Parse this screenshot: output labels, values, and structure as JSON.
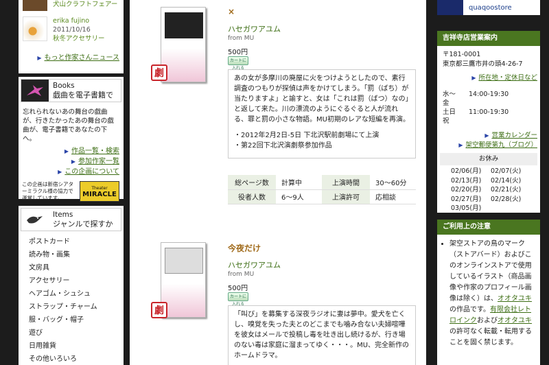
{
  "left": {
    "news": {
      "item1_label": "犬山クラフトフェアー",
      "item2_author": "erika fujino",
      "item2_date": "2011/10/16",
      "item2_label": "秋冬アクセサリー",
      "more_link": "もっと作家さんニュース"
    },
    "books": {
      "title": "Books",
      "subtitle": "戯曲を電子書籍で",
      "description": "忘れられないあの舞台の戯曲が、行きたかったあの舞台の戯曲が、電子書籍であなたの下へ。",
      "links": [
        "作品一覧・検索",
        "参加作家一覧",
        "この企画について"
      ],
      "miracle_text": "この企画は新宿シアターミラクル様の協力で運営しています。",
      "miracle_logo_top": "Theater",
      "miracle_logo_main": "MIRACLE"
    },
    "items": {
      "title": "Items",
      "subtitle": "ジャンルで探すか",
      "list": [
        "ポストカード",
        "読み物・画集",
        "文房具",
        "アクセサリー",
        "ヘアゴム・シュシュ",
        "ストラップ・チャーム",
        "服・バッグ・帽子",
        "遊び",
        "日用雑貨",
        "その他いろいろ"
      ]
    }
  },
  "main": {
    "products": [
      {
        "title": "×",
        "author": "ハセガワアユム",
        "from": "from MU",
        "price": "500円",
        "cart": "カートに入れる",
        "badge": "劇",
        "description": "あの女が多摩川の廃屋に火をつけようとしたので、素行調査のつもりが探偵は声をかけてしまう。「罰（ばち）が当たりますよ」と諭すと、女は「これは罰（ばつ）なの」と返して来た。川の漂流のようにぐるぐると人が流れる、罪と罰の小さな物語。MU初期のレアな短編を再演。",
        "notes": [
          "・2012年2月2日-5日 下北沢駅前劇場にて上演",
          "・第22回下北沢演劇祭参加作品"
        ],
        "spec": [
          {
            "k1": "総ページ数",
            "v1": "計算中",
            "k2": "上演時間",
            "v2": "30〜60分"
          },
          {
            "k1": "役者人数",
            "v1": "6〜9人",
            "k2": "上演許可",
            "v2": "応相談"
          }
        ]
      },
      {
        "title": "今夜だけ",
        "author": "ハセガワアユム",
        "from": "from MU",
        "price": "500円",
        "cart": "カートに入れる",
        "badge": "劇",
        "description": "「叫び」を募集する深夜ラジオに妻は夢中。愛犬を亡くし、嗅覚を失った夫とのどこまでも噛み合ない夫婦喧嘩を彼女はメールで投稿し毒を吐き出し続けるが、行き場のない毒は家庭に溜まってゆく・・・。MU、完全新作のホームドラマ。"
      }
    ]
  },
  "right": {
    "store_name": "quaqoostore",
    "shop": {
      "header": "吉祥寺店営業案内",
      "zip": "〒181-0001",
      "address": "東京都三鷹市井の頭4-26-7",
      "access_link": "所在地・定休日など",
      "hours": [
        {
          "day": "水〜金",
          "time": "14:00-19:30"
        },
        {
          "day": "土日祝",
          "time": "11:00-19:30"
        }
      ],
      "calendar_link": "営業カレンダー",
      "blog_link": "架空郵便第九（ブログ）",
      "closed_header": "お休み",
      "closed_days": [
        "02/06(月)",
        "02/07(火)",
        "02/13(月)",
        "02/14(火)",
        "02/20(月)",
        "02/21(火)",
        "02/27(月)",
        "02/28(火)",
        "03/05(月)"
      ]
    },
    "notice": {
      "header": "ご利用上の注意",
      "text_1": "架空ストアの鳥のマーク（ストアバード）およびこのオンラインストアで使用しているイラスト（商品画像や作家のプロフィール画像は除く）は、",
      "link_1": "オオタユキ",
      "text_2": "の作品です。",
      "link_2": "有限会社レトロインク",
      "text_3": "および",
      "link_3": "オオタユキ",
      "text_4": "の許可なく転載・転用することを固く禁じます。"
    }
  }
}
